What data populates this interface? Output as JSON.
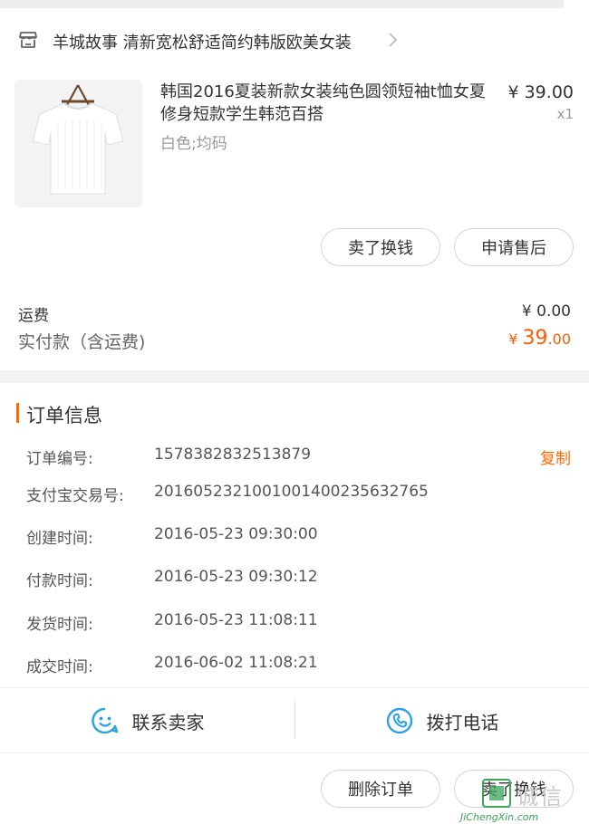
{
  "shop": {
    "name": "羊城故事 清新宽松舒适简约韩版欧美女装"
  },
  "product": {
    "title": "韩国2016夏装新款女装纯色圆领短袖t恤女夏修身短款学生韩范百搭",
    "variant": "白色;均码",
    "price": "¥ 39.00",
    "quantity": "x1"
  },
  "item_actions": {
    "sell_label": "卖了换钱",
    "after_sales_label": "申请售后"
  },
  "totals": {
    "shipping_label": "运费",
    "shipping_value": "¥ 0.00",
    "paid_label": "实付款（含运费)",
    "paid_currency": "¥ ",
    "paid_integer": "39",
    "paid_decimal": ".00"
  },
  "order_info": {
    "title": "订单信息",
    "copy_label": "复制",
    "rows": [
      {
        "label": "订单编号:",
        "value": "1578382832513879"
      },
      {
        "label": "支付宝交易号:",
        "value": "2016052321001001400235632765"
      },
      {
        "label": "创建时间:",
        "value": "2016-05-23 09:30:00"
      },
      {
        "label": "付款时间:",
        "value": "2016-05-23 09:30:12"
      },
      {
        "label": "发货时间:",
        "value": "2016-05-23 11:08:11"
      },
      {
        "label": "成交时间:",
        "value": "2016-06-02 11:08:21"
      }
    ]
  },
  "contact": {
    "seller_label": "联系卖家",
    "phone_label": "拨打电话"
  },
  "footer_actions": {
    "delete_label": "删除订单",
    "resell_label": "卖了换钱"
  },
  "watermark": {
    "text": "JiChengXin.com",
    "cn_text": "诚信"
  },
  "colors": {
    "accent": "#ff6a00",
    "price": "#ff5a00",
    "icon_blue": "#2aa3e6",
    "watermark_green": "#3aa55b"
  }
}
